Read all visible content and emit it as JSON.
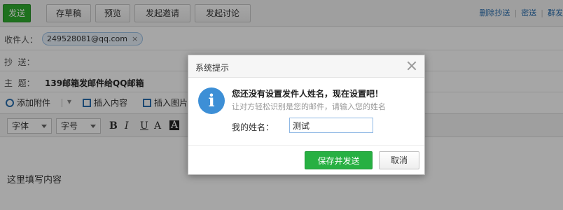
{
  "toolbar": {
    "send_label": "发送",
    "draft_label": "存草稿",
    "preview_label": "预览",
    "invite_label": "发起邀请",
    "discuss_label": "发起讨论"
  },
  "top_links": {
    "remove_cc": "删除抄送",
    "bcc": "密送",
    "group_send": "群发"
  },
  "compose": {
    "to_label": "收件人：",
    "to_recipient": "249528081@qq.com",
    "cc_label": "抄  送：",
    "subject_label": "主  题：",
    "subject_value": "139邮箱发邮件给QQ邮箱"
  },
  "attach_bar": {
    "attach_label": "添加附件",
    "insert_content_label": "插入内容",
    "insert_image_label": "插入图片"
  },
  "format_bar": {
    "font_label": "字体",
    "size_label": "字号",
    "bold": "B",
    "italic": "I",
    "underline": "U",
    "font_color": "A",
    "bg_color": "A"
  },
  "editor": {
    "placeholder": "这里填写内容"
  },
  "dialog": {
    "title": "系统提示",
    "icon_glyph": "i",
    "message": "您还没有设置发件人姓名，现在设置吧！",
    "sub_message": "让对方轻松识别是您的邮件，请输入您的姓名",
    "name_label": "我的姓名：",
    "name_value": "测试",
    "save_send_label": "保存并发送",
    "cancel_label": "取消"
  },
  "colors": {
    "send_green": "#2fae2f",
    "save_green": "#27b042",
    "info_blue": "#3d8fd6",
    "link_blue": "#2a6fb0"
  }
}
